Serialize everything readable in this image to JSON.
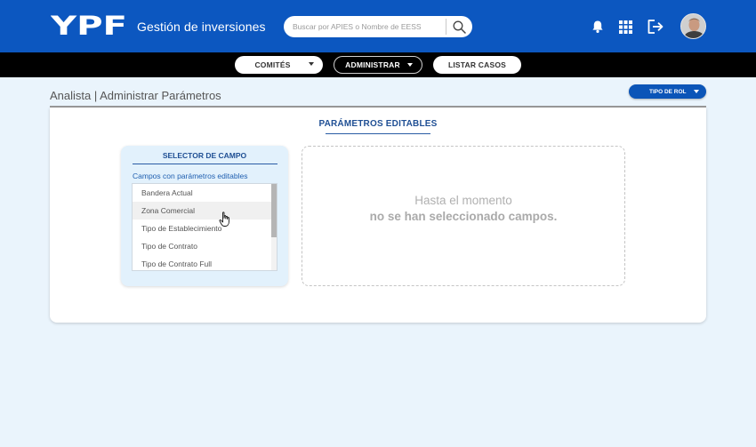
{
  "header": {
    "logo_text": "YPF",
    "app_title": "Gestión de inversiones",
    "search_placeholder": "Buscar por APIES o Nombre de EESS",
    "icons": [
      "search-icon",
      "bell-icon",
      "apps-grid-icon",
      "logout-icon",
      "avatar"
    ]
  },
  "nav": {
    "items": [
      {
        "label": "COMITÉS",
        "style": "white",
        "has_caret": true
      },
      {
        "label": "ADMINISTRAR",
        "style": "dark",
        "has_caret": true
      },
      {
        "label": "LISTAR CASOS",
        "style": "white",
        "has_caret": false
      }
    ]
  },
  "breadcrumb": "Analista | Administrar Parámetros",
  "role_selector": {
    "label": "TIPO DE ROL"
  },
  "main": {
    "section_title": "PARÁMETROS EDITABLES",
    "selector": {
      "title": "SELECTOR DE CAMPO",
      "subtitle": "Campos con parámetros editables",
      "items": [
        "Bandera Actual",
        "Zona Comercial",
        "Tipo de Establecimiento",
        "Tipo de Contrato",
        "Tipo de Contrato Full"
      ],
      "hovered_item": "Zona Comercial"
    },
    "empty_state": {
      "line1": "Hasta el momento",
      "line2": "no se han seleccionado campos."
    }
  },
  "colors": {
    "header_bg": "#0c57c0",
    "nav_bg": "#000000",
    "page_bg": "#eaf4fc",
    "accent": "#1f4f94"
  }
}
